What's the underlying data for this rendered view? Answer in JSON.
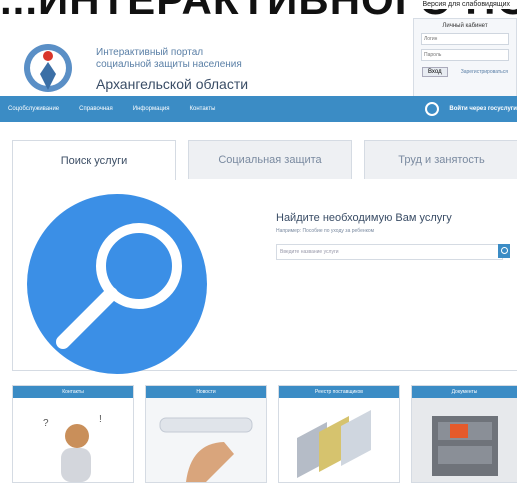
{
  "banner": {
    "top_text": "...ИНТЕРАКТИВНОГО ПОРТАЛА"
  },
  "top": {
    "link_text": "Версия для слабовидящих"
  },
  "header": {
    "line1": "Интерактивный портал",
    "line2": "социальной защиты населения",
    "line3": "Архангельской области"
  },
  "login": {
    "title": "Личный кабинет",
    "login_placeholder": "Логин",
    "password_placeholder": "Пароль",
    "enter": "Вход",
    "register": "Зарегистрироваться"
  },
  "nav": {
    "items": [
      "Соцобслуживание",
      "Справочная",
      "Информация",
      "Контакты"
    ],
    "search_label": "Войти через госуслуги"
  },
  "tabs": [
    "Поиск услуги",
    "Социальная защита",
    "Труд и занятость"
  ],
  "panel": {
    "title": "Найдите необходимую Вам услугу",
    "subtitle": "Например: Пособие по уходу за ребенком",
    "input_placeholder": "Введите название услуги"
  },
  "cards": [
    {
      "label": "Контакты"
    },
    {
      "label": "Новости"
    },
    {
      "label": "Реестр поставщиков"
    },
    {
      "label": "Документы"
    }
  ],
  "colors": {
    "nav_bg": "#3b8cc5",
    "circle": "#3b8fe6"
  }
}
